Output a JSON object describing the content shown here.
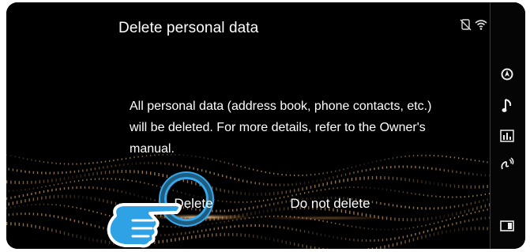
{
  "header": {
    "title": "Delete personal data",
    "status_icons": [
      "phone-disconnected-icon",
      "wifi-icon"
    ]
  },
  "dialog": {
    "message_lines": [
      "All personal data (address book, phone contacts, etc.)",
      "will be deleted. For more details, refer to the Owner's",
      "manual."
    ]
  },
  "buttons": {
    "delete_label": "Delete",
    "do_not_delete_label": "Do not delete"
  },
  "sidebar": {
    "items": [
      {
        "icon": "navigation-icon",
        "glyph": "◑"
      },
      {
        "icon": "music-note-icon",
        "glyph": "♪"
      },
      {
        "icon": "equalizer-icon",
        "glyph": ""
      },
      {
        "icon": "voice-icon",
        "glyph": ""
      },
      {
        "icon": "display-icon",
        "glyph": ""
      }
    ]
  },
  "colors": {
    "accent_ring": "#37a8ea",
    "hand": "#2fa2e6",
    "wave": "#d9a36b"
  }
}
